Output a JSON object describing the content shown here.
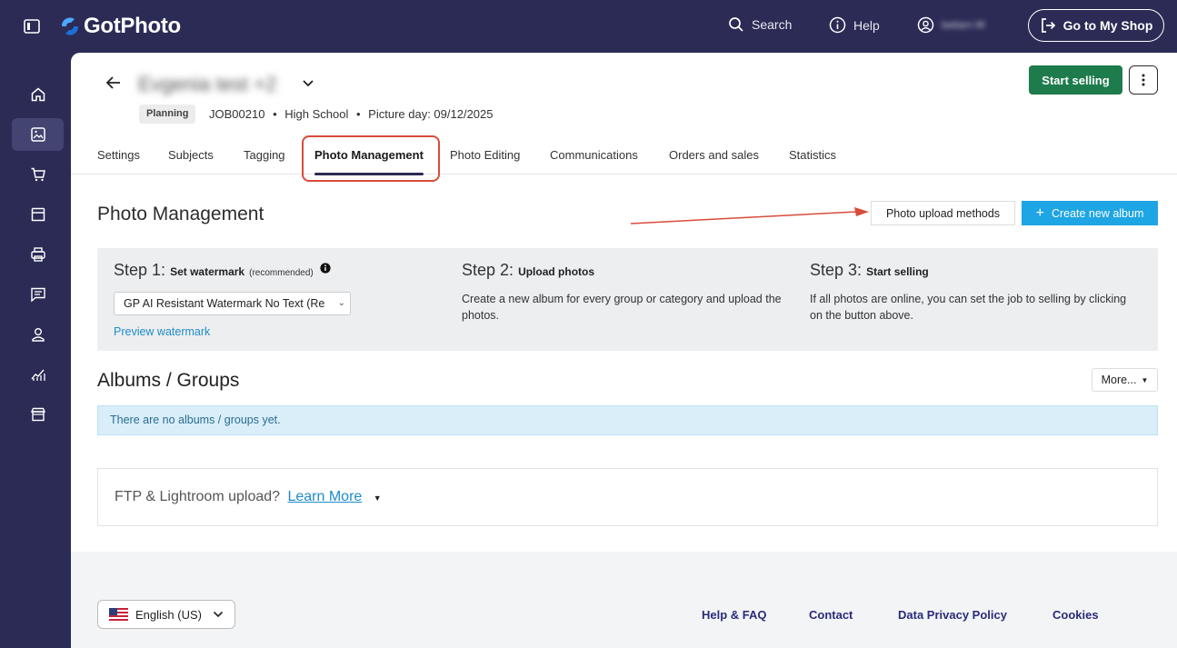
{
  "app": {
    "name": "GotPhoto"
  },
  "topbar": {
    "search_label": "Search",
    "help_label": "Help",
    "user_name": "bettarn lifi",
    "shop_button": "Go to My Shop"
  },
  "sidebar": {
    "items": [
      {
        "name": "home",
        "icon": "home-icon"
      },
      {
        "name": "photos",
        "icon": "image-icon",
        "active": true
      },
      {
        "name": "cart",
        "icon": "cart-icon"
      },
      {
        "name": "store",
        "icon": "store-icon"
      },
      {
        "name": "print",
        "icon": "printer-icon"
      },
      {
        "name": "messages",
        "icon": "message-icon"
      },
      {
        "name": "users",
        "icon": "user-icon"
      },
      {
        "name": "analytics",
        "icon": "chart-icon"
      },
      {
        "name": "shop",
        "icon": "shop-icon"
      }
    ]
  },
  "job": {
    "title": "Evgenia test +2",
    "status": "Planning",
    "id": "JOB00210",
    "type": "High School",
    "picture_day": "Picture day: 09/12/2025",
    "start_selling": "Start selling"
  },
  "tabs": [
    {
      "label": "Settings"
    },
    {
      "label": "Subjects"
    },
    {
      "label": "Tagging"
    },
    {
      "label": "Photo Management",
      "active": true
    },
    {
      "label": "Photo Editing"
    },
    {
      "label": "Communications"
    },
    {
      "label": "Orders and sales"
    },
    {
      "label": "Statistics"
    }
  ],
  "photo_management": {
    "title": "Photo Management",
    "upload_methods": "Photo upload methods",
    "create_album": "Create new album",
    "steps": [
      {
        "prefix": "Step 1:",
        "title": "Set watermark",
        "note": "(recommended)"
      },
      {
        "prefix": "Step 2:",
        "title": "Upload photos",
        "desc": "Create a new album for every group or category and upload the photos."
      },
      {
        "prefix": "Step 3:",
        "title": "Start selling",
        "desc": "If all photos are online, you can set the job to selling by clicking on the button above."
      }
    ],
    "watermark_value": "GP AI Resistant Watermark No Text (Re",
    "preview_watermark": "Preview watermark"
  },
  "albums": {
    "title": "Albums / Groups",
    "more": "More...",
    "empty": "There are no albums / groups yet."
  },
  "ftp": {
    "text": "FTP & Lightroom upload?",
    "link": "Learn More"
  },
  "footer": {
    "language": "English (US)",
    "links": [
      "Help & FAQ",
      "Contact",
      "Data Privacy Policy",
      "Cookies"
    ]
  },
  "colors": {
    "brand_dark": "#2b2b55",
    "success": "#1e7b4c",
    "primary": "#1ea5e3",
    "highlight": "#d94b3b"
  }
}
